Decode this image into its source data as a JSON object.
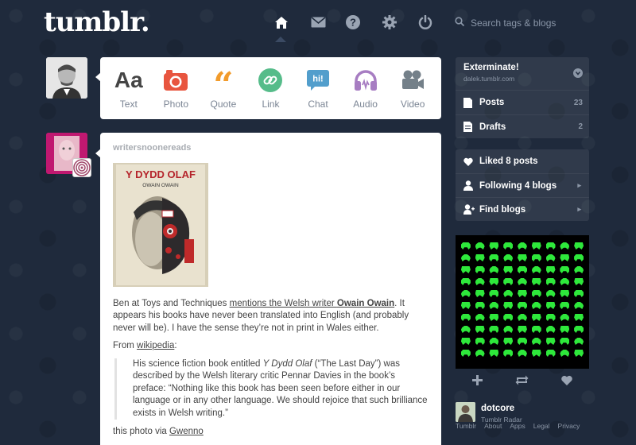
{
  "header": {
    "logo": "tumblr.",
    "nav": [
      "home-icon",
      "envelope-icon",
      "help-icon",
      "gear-icon",
      "power-icon"
    ],
    "search_placeholder": "Search tags & blogs"
  },
  "composer": {
    "types": [
      {
        "label": "Text",
        "icon": "text-icon",
        "color": "#444444"
      },
      {
        "label": "Photo",
        "icon": "camera-icon",
        "color": "#e8553f"
      },
      {
        "label": "Quote",
        "icon": "quote-icon",
        "color": "#f29b2b"
      },
      {
        "label": "Link",
        "icon": "link-icon",
        "color": "#56bc8a"
      },
      {
        "label": "Chat",
        "icon": "chat-icon",
        "color": "#529ecc"
      },
      {
        "label": "Audio",
        "icon": "headphones-icon",
        "color": "#a77dc2"
      },
      {
        "label": "Video",
        "icon": "video-camera-icon",
        "color": "#748089"
      }
    ]
  },
  "post": {
    "author": "writersnoonereads",
    "book_title": "Y DYDD OLAF",
    "book_author": "OWAIN OWAIN",
    "para1_pre": "Ben at Toys and Techniques ",
    "para1_link": "mentions the Welsh writer ",
    "para1_bold": "Owain Owain",
    "para1_post": ". It appears his books have never been translated into English (and probably never will be). I have the sense they’re not in print in Wales either.",
    "from_label": "From ",
    "from_link": "wikipedia",
    "from_colon": ":",
    "quote_pre": "His science fiction book entitled ",
    "quote_title": "Y Dydd Olaf",
    "quote_post": " (“The Last Day”) was described by the Welsh literary critic Pennar Davies in the book’s preface: “Nothing like this book has been seen before either in our language or in any other language. We should rejoice that such brilliance exists in Welsh writing.”",
    "via_label": "this photo via ",
    "via_link": "Gwenno"
  },
  "sidebar": {
    "blog_title": "Exterminate!",
    "blog_url": "dalek.tumblr.com",
    "posts_label": "Posts",
    "posts_count": "23",
    "drafts_label": "Drafts",
    "drafts_count": "2",
    "liked_label": "Liked 8 posts",
    "following_label": "Following 4 blogs",
    "find_label": "Find blogs"
  },
  "footer": {
    "name": "dotcore",
    "sub": "Tumblr Radar",
    "links": [
      "Tumblr",
      "About",
      "Apps",
      "Legal",
      "Privacy"
    ]
  },
  "colors": {
    "background": "#1f2a3c",
    "invader_green": "#2ee83b"
  }
}
